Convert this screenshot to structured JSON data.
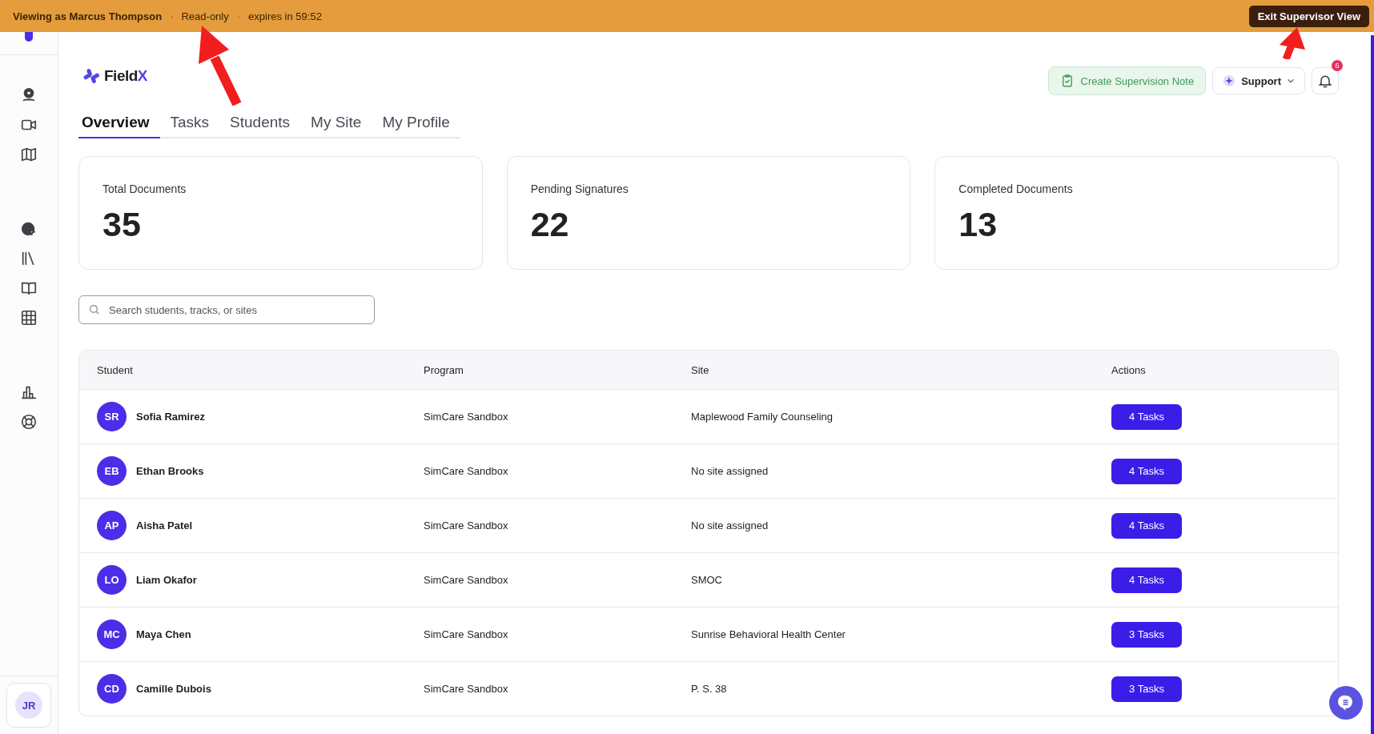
{
  "banner": {
    "viewing": "Viewing as Marcus Thompson",
    "separator_1": "·",
    "mode": "Read-only",
    "separator_2": "·",
    "expires": "expires in 59:52",
    "exit_button": "Exit Supervisor View"
  },
  "sidebar": {
    "avatar": "JR"
  },
  "brand": {
    "name": "Field",
    "accent": "X"
  },
  "header_actions": {
    "note_button": "Create Supervision Note",
    "support_button": "Support",
    "notification_count": "6"
  },
  "tabs": [
    {
      "label": "Overview",
      "selected": true
    },
    {
      "label": "Tasks",
      "selected": false
    },
    {
      "label": "Students",
      "selected": false
    },
    {
      "label": "My Site",
      "selected": false
    },
    {
      "label": "My Profile",
      "selected": false
    }
  ],
  "stats": [
    {
      "label": "Total Documents",
      "value": "35"
    },
    {
      "label": "Pending Signatures",
      "value": "22"
    },
    {
      "label": "Completed Documents",
      "value": "13"
    }
  ],
  "search": {
    "placeholder": "Search students, tracks, or sites"
  },
  "table": {
    "columns": [
      "Student",
      "Program",
      "Site",
      "Actions"
    ],
    "rows": [
      {
        "initials": "SR",
        "student": "Sofia Ramirez",
        "program": "SimCare Sandbox",
        "site": "Maplewood Family Counseling",
        "action": "4 Tasks"
      },
      {
        "initials": "EB",
        "student": "Ethan Brooks",
        "program": "SimCare Sandbox",
        "site": "No site assigned",
        "action": "4 Tasks"
      },
      {
        "initials": "AP",
        "student": "Aisha Patel",
        "program": "SimCare Sandbox",
        "site": "No site assigned",
        "action": "4 Tasks"
      },
      {
        "initials": "LO",
        "student": "Liam Okafor",
        "program": "SimCare Sandbox",
        "site": "SMOC",
        "action": "4 Tasks"
      },
      {
        "initials": "MC",
        "student": "Maya Chen",
        "program": "SimCare Sandbox",
        "site": "Sunrise Behavioral Health Center",
        "action": "3 Tasks"
      },
      {
        "initials": "CD",
        "student": "Camille Dubois",
        "program": "SimCare Sandbox",
        "site": "P. S. 38",
        "action": "3 Tasks"
      }
    ]
  }
}
